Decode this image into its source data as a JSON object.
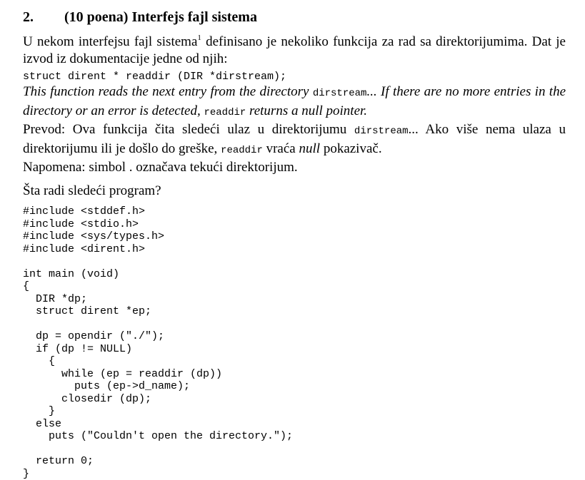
{
  "heading": {
    "number": "2.",
    "title": "(10 poena) Interfejs fajl sistema"
  },
  "intro": {
    "text_before_sup": "U nekom interfejsu fajl sistema",
    "superscript": "1",
    "text_after_sup": " definisano je nekoliko funkcija za rad sa direktorijumima. Dat je izvod iz dokumentacije jedne od njih:"
  },
  "prototype": "struct dirent * readdir (DIR *dirstream);",
  "english_doc": {
    "part1": "This function reads the next entry from the directory ",
    "code1": "dirstream",
    "part2": "... If there are no more entries in the directory or an error is detected, ",
    "code2": "readdir",
    "part3": " returns a null pointer."
  },
  "translation": {
    "part1": "Prevod: Ova funkcija čita sledeći ulaz u direktorijumu ",
    "code1": "dirstream",
    "part2": "... Ako više nema ulaza u direktorijumu ili je došlo do greške, ",
    "code2": "readdir",
    "part3": " vraća ",
    "italic": "null",
    "part4": " pokazivač."
  },
  "note": "Napomena: simbol . označava tekući direktorijum.",
  "question": "Šta radi sledeći program?",
  "code_lines": [
    "#include <stddef.h>",
    "#include <stdio.h>",
    "#include <sys/types.h>",
    "#include <dirent.h>",
    "",
    "int main (void)",
    "{",
    "  DIR *dp;",
    "  struct dirent *ep;",
    "",
    "  dp = opendir (\"./\");",
    "  if (dp != NULL)",
    "    {",
    "      while (ep = readdir (dp))",
    "        puts (ep->d_name);",
    "      closedir (dp);",
    "    }",
    "  else",
    "    puts (\"Couldn't open the directory.\");",
    "",
    "  return 0;",
    "}"
  ]
}
